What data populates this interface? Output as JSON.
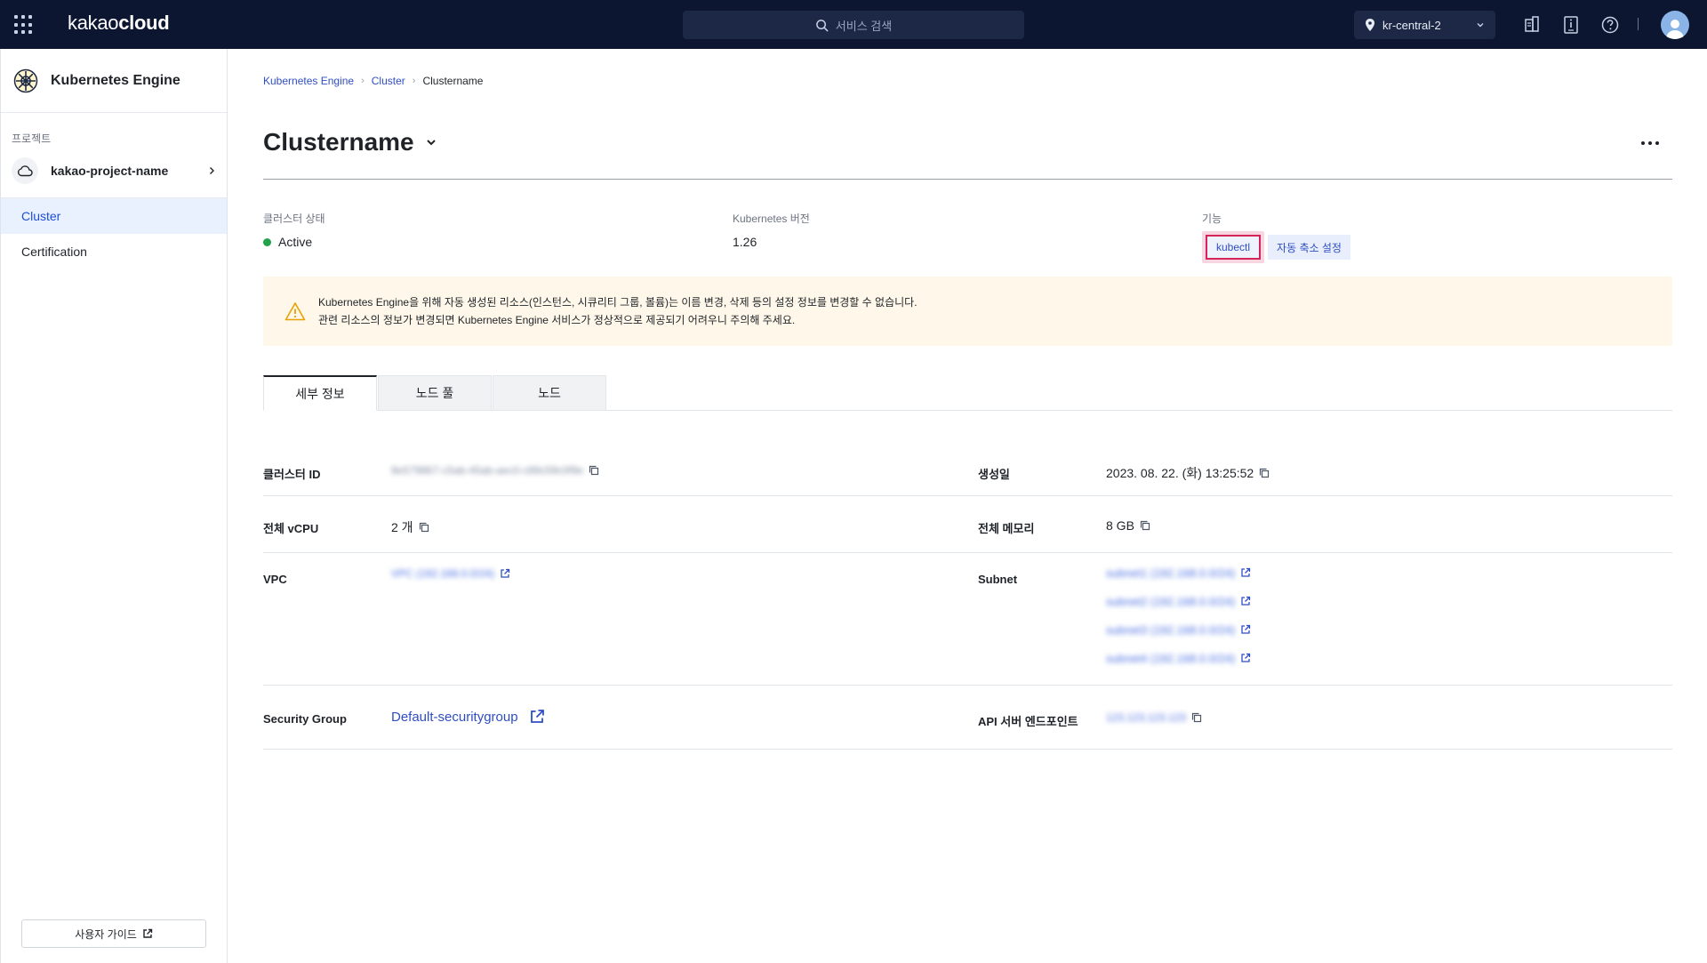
{
  "topbar": {
    "brand_light": "kakao",
    "brand_bold": "cloud",
    "search_placeholder": "서비스 검색",
    "region": "kr-central-2"
  },
  "sidebar": {
    "service_title": "Kubernetes Engine",
    "project_label": "프로젝트",
    "project_name": "kakao-project-name",
    "nav": [
      "Cluster",
      "Certification"
    ],
    "guide_label": "사용자 가이드"
  },
  "breadcrumb": [
    "Kubernetes Engine",
    "Cluster",
    "Clustername"
  ],
  "page_title": "Clustername",
  "summary": {
    "status_label": "클러스터 상태",
    "status_value": "Active",
    "version_label": "Kubernetes 버전",
    "version_value": "1.26",
    "feature_label": "기능",
    "feature_kubectl": "kubectl",
    "feature_autoscale": "자동 축소 설정"
  },
  "warning": {
    "line1": "Kubernetes Engine을 위해 자동 생성된 리소스(인스턴스, 시큐리티 그룹, 볼륨)는 이름 변경, 삭제 등의 설정 정보를 변경할 수 없습니다.",
    "line2": "관련 리소스의 정보가 변경되면 Kubernetes Engine 서비스가 정상적으로 제공되기 어려우니 주의해 주세요."
  },
  "tabs": [
    "세부 정보",
    "노드 풀",
    "노드"
  ],
  "details": {
    "cluster_id_label": "클러스터 ID",
    "cluster_id_value": "8e579867-c5ab-45ab-aec0-c89c59c0f9e",
    "created_label": "생성일",
    "created_value": "2023. 08. 22. (화) 13:25:52",
    "vcpu_label": "전체 vCPU",
    "vcpu_value": "2 개",
    "memory_label": "전체 메모리",
    "memory_value": "8 GB",
    "vpc_label": "VPC",
    "vpc_value": "VPC (192.168.0.0/24)",
    "subnet_label": "Subnet",
    "subnets": [
      "subnet1 (192.168.0.0/24)",
      "subnet2 (192.168.0.0/24)",
      "subnet3 (192.168.0.0/24)",
      "subnet4 (192.168.0.0/24)"
    ],
    "sg_label": "Security Group",
    "sg_value": "Default-securitygroup",
    "api_label": "API 서버 엔드포인트",
    "api_value": "123.123.123.123"
  },
  "colors": {
    "nav_bg": "#0c1631",
    "accent": "#2f4ec4",
    "active_status": "#22a34a",
    "highlight": "#d4245a"
  }
}
